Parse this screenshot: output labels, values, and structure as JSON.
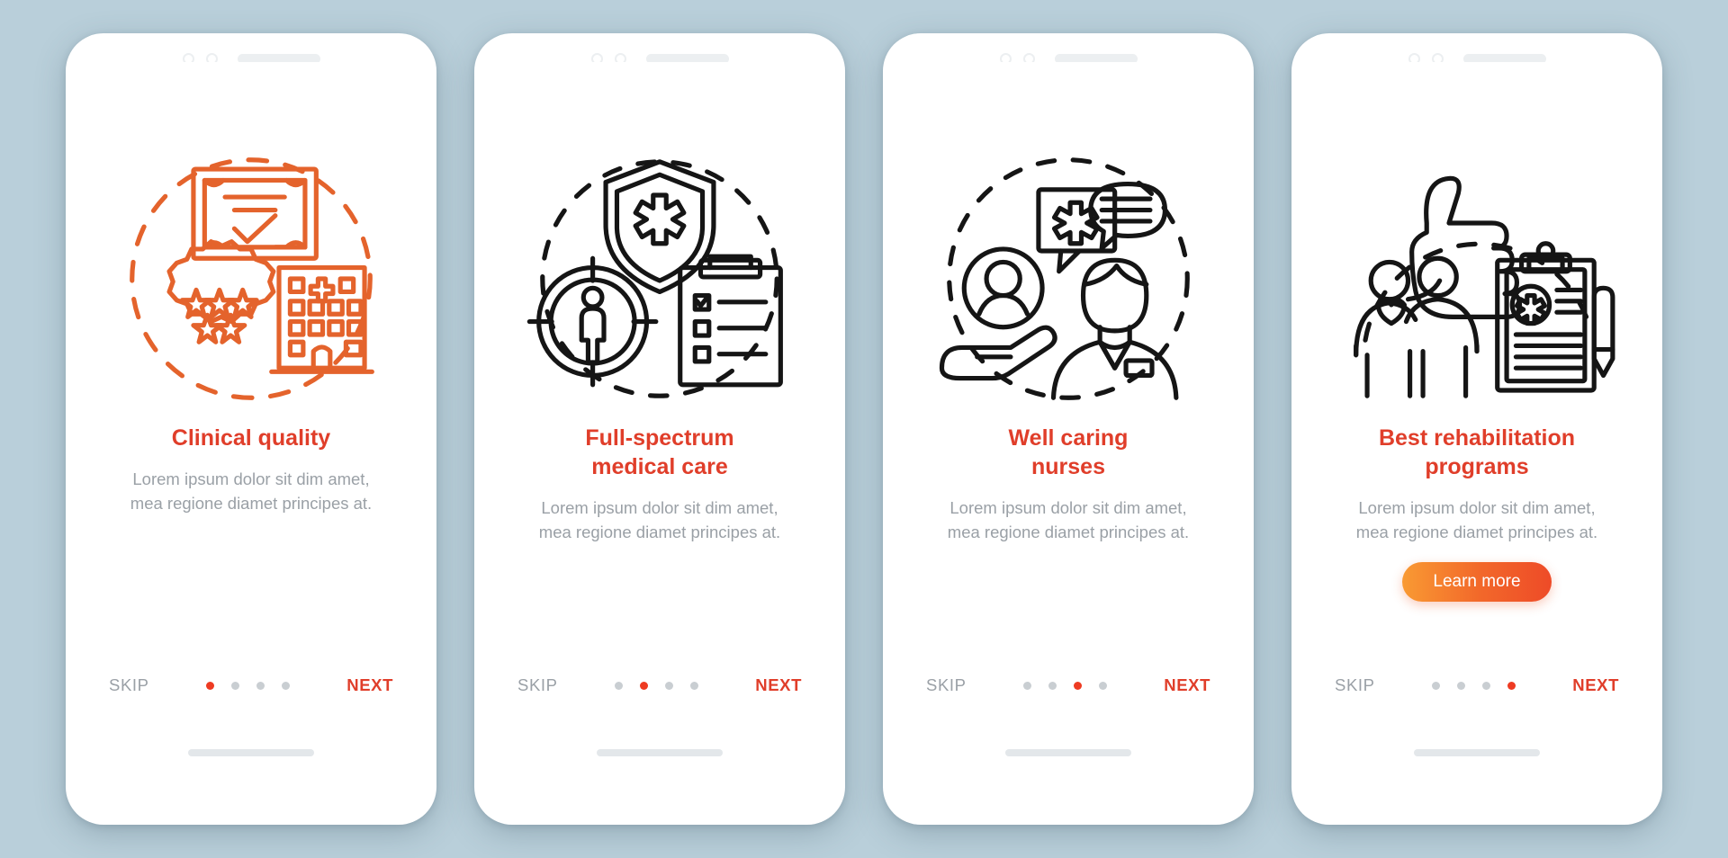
{
  "background_color": "#b9cfda",
  "accent_color": "#e03e2a",
  "muted_color": "#9aa0a6",
  "dot_active_color": "#ee3b22",
  "dot_inactive_color": "#c9ced2",
  "common": {
    "skip_label": "SKIP",
    "next_label": "NEXT",
    "body_text": "Lorem ipsum dolor sit dim amet, mea regione diamet principes at.",
    "dot_count": 4
  },
  "screens": [
    {
      "id": "clinical-quality",
      "title": "Clinical quality",
      "body": "Lorem ipsum dolor sit dim amet, mea regione diamet principes at.",
      "skip_label": "SKIP",
      "next_label": "NEXT",
      "active_dot": 1,
      "illustration_style": "orange-outline",
      "illustration_icons": [
        "certificate-icon",
        "star-badge-icon",
        "hospital-building-icon",
        "dashed-circle-icon"
      ],
      "cta": null
    },
    {
      "id": "full-spectrum-medical-care",
      "title": "Full-spectrum\nmedical care",
      "body": "Lorem ipsum dolor sit dim amet, mea regione diamet principes at.",
      "skip_label": "SKIP",
      "next_label": "NEXT",
      "active_dot": 2,
      "illustration_style": "black-outline",
      "illustration_icons": [
        "shield-medical-icon",
        "target-person-icon",
        "clipboard-checklist-icon",
        "dashed-circle-icon"
      ],
      "cta": null
    },
    {
      "id": "well-caring-nurses",
      "title": "Well caring\nnurses",
      "body": "Lorem ipsum dolor sit dim amet, mea regione diamet principes at.",
      "skip_label": "SKIP",
      "next_label": "NEXT",
      "active_dot": 3,
      "illustration_style": "black-outline",
      "illustration_icons": [
        "hand-patient-icon",
        "speech-bubble-medical-icon",
        "nurse-icon",
        "dashed-circle-icon"
      ],
      "cta": null
    },
    {
      "id": "best-rehabilitation-programs",
      "title": "Best rehabilitation\nprograms",
      "body": "Lorem ipsum dolor sit dim amet, mea regione diamet principes at.",
      "skip_label": "SKIP",
      "next_label": "NEXT",
      "active_dot": 4,
      "illustration_style": "black-outline",
      "illustration_icons": [
        "thumbs-up-icon",
        "two-people-heart-icon",
        "clipboard-pen-icon",
        "dashed-arc-icon"
      ],
      "cta": {
        "label": "Learn more",
        "gradient_from": "#f99a33",
        "gradient_to": "#ee4b28"
      }
    }
  ]
}
